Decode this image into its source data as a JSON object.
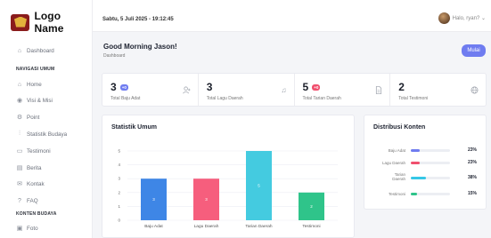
{
  "app": {
    "logo_text": "Logo Name"
  },
  "header": {
    "datetime": "Sabtu, 5 Juli 2025 - 19:12:45",
    "user_label": "Halo, ryan? ⌄"
  },
  "sidebar": {
    "items": [
      {
        "label": "Dashboard",
        "icon": "home-icon"
      },
      {
        "label": "Home",
        "icon": "home-icon"
      },
      {
        "label": "Visi & Misi",
        "icon": "eye-icon"
      },
      {
        "label": "Point",
        "icon": "gear-icon"
      },
      {
        "label": "Statistik Budaya",
        "icon": "chart-icon"
      },
      {
        "label": "Testimoni",
        "icon": "chat-icon"
      },
      {
        "label": "Berita",
        "icon": "news-icon"
      },
      {
        "label": "Kontak",
        "icon": "mail-icon"
      },
      {
        "label": "FAQ",
        "icon": "question-icon"
      },
      {
        "label": "Foto",
        "icon": "image-icon"
      }
    ],
    "sections": [
      "NAVIGASI UMUM",
      "KONTEN BUDAYA"
    ]
  },
  "greeting": {
    "title": "Good Morning Jason!",
    "subtitle": "Dashboard",
    "button": "Mulai"
  },
  "stats": [
    {
      "value": "3",
      "badge": "+0",
      "badge_color": "#6f7cf0",
      "label": "Total Baju Adat",
      "icon": "user-plus-icon"
    },
    {
      "value": "3",
      "badge": "",
      "badge_color": "",
      "label": "Total Lagu Daerah",
      "icon": "music-icon"
    },
    {
      "value": "5",
      "badge": "+0",
      "badge_color": "#f0506e",
      "label": "Total Tarian Daerah",
      "icon": "file-icon"
    },
    {
      "value": "2",
      "badge": "",
      "badge_color": "",
      "label": "Total Testimoni",
      "icon": "globe-icon"
    }
  ],
  "statistik": {
    "title": "Statistik Umum"
  },
  "distribusi": {
    "title": "Distribusi Konten",
    "rows": [
      {
        "label": "Baju Adat",
        "pct": "23%",
        "value": 0.23,
        "color": "#6f7cf0"
      },
      {
        "label": "Lagu Daerah",
        "pct": "23%",
        "value": 0.23,
        "color": "#f0506e"
      },
      {
        "label": "Tarian Daerah",
        "pct": "38%",
        "value": 0.38,
        "color": "#35c7e6"
      },
      {
        "label": "Testimoni",
        "pct": "15%",
        "value": 0.15,
        "color": "#2fc48a"
      }
    ]
  },
  "chart_data": {
    "type": "bar",
    "categories": [
      "Baju Adat",
      "Lagu Daerah",
      "Tarian Daerah",
      "Testimoni"
    ],
    "values": [
      3,
      3,
      5,
      2
    ],
    "colors": [
      "#3e86e6",
      "#f65e7d",
      "#44cbe0",
      "#2fc48a"
    ],
    "ylim": [
      0,
      5
    ],
    "yticks": [
      0,
      1,
      2,
      3,
      4,
      5
    ],
    "grid": true
  }
}
